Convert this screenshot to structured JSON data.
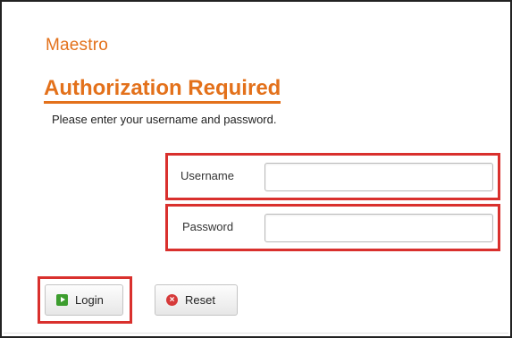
{
  "brand": "Maestro",
  "page_title": "Authorization Required",
  "instructions": "Please enter your username and password.",
  "form": {
    "username_label": "Username",
    "username_value": "",
    "password_label": "Password",
    "password_value": ""
  },
  "buttons": {
    "login_label": "Login",
    "reset_label": "Reset"
  },
  "icons": {
    "login": "login-icon",
    "reset": "reset-icon"
  },
  "colors": {
    "brand_orange": "#e3711b",
    "highlight_red": "#d9302d",
    "login_green": "#3c9d2e",
    "reset_red": "#d63a3a"
  }
}
